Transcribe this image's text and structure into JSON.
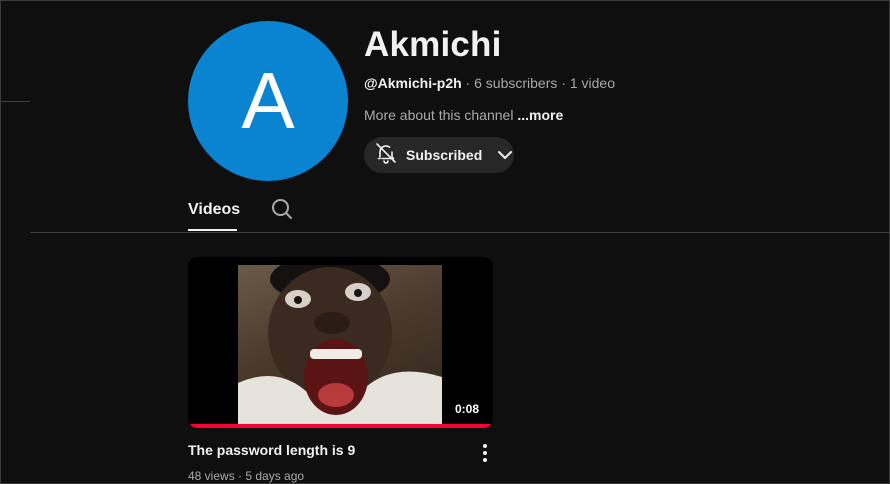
{
  "channel": {
    "avatar_letter": "A",
    "avatar_color": "#0a84d0",
    "name": "Akmichi",
    "handle": "@Akmichi-p2h",
    "separator": " · ",
    "subscribers": "6 subscribers",
    "video_count": "1 video",
    "about": "More about this channel",
    "more_label": "...more",
    "subscribe_label": "Subscribed",
    "subscribe_icon": "bell-off-icon"
  },
  "tabs": {
    "videos_label": "Videos",
    "search_icon": "search-icon"
  },
  "video": {
    "title": "The password length is 9",
    "views": "48 views",
    "age": "5 days ago",
    "duration": "0:08",
    "watched_fraction": 1.0,
    "progress_color": "#ff0033",
    "menu_icon": "more-vert-icon"
  }
}
